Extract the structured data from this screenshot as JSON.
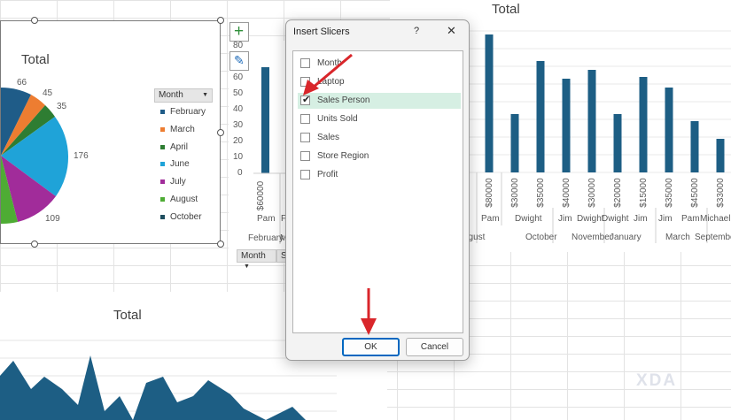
{
  "pie_chart": {
    "title": "Total",
    "slice_labels": [
      "66",
      "45",
      "35",
      "176",
      "109"
    ],
    "legend_header": "Month",
    "legend": [
      {
        "label": "February",
        "color": "#1f5c88"
      },
      {
        "label": "March",
        "color": "#ed7d31"
      },
      {
        "label": "April",
        "color": "#2e7d32"
      },
      {
        "label": "June",
        "color": "#1fa3d8"
      },
      {
        "label": "July",
        "color": "#a12c9a"
      },
      {
        "label": "August",
        "color": "#4eac34"
      },
      {
        "label": "October",
        "color": "#1f4e5f"
      }
    ]
  },
  "mid_chart": {
    "y_ticks": [
      "80",
      "70",
      "60",
      "50",
      "40",
      "30",
      "20",
      "10",
      "0"
    ],
    "bar_cat": "$60000",
    "person": "Pam",
    "person_cut": "F",
    "month": "February",
    "month_cut": "M",
    "field_btn": "Month",
    "field_btn2": "Sa"
  },
  "right_chart": {
    "title": "Total",
    "categories": [
      "$80000",
      "$30000",
      "$35000",
      "$40000",
      "$30000",
      "$20000",
      "$15000",
      "$35000",
      "$45000",
      "$33000"
    ],
    "persons": [
      "h",
      "Pam",
      "Dwight",
      "Jim",
      "Dwight",
      "Dwight",
      "Jim",
      "Jim",
      "Pam",
      "Michael"
    ],
    "months": [
      "ugust",
      "October",
      "November",
      "January",
      "March",
      "September"
    ]
  },
  "area_chart": {
    "title": "Total"
  },
  "dialog": {
    "title": "Insert Slicers",
    "help": "?",
    "close": "✕",
    "fields": [
      {
        "label": "Month",
        "checked": false
      },
      {
        "label": "Laptop",
        "checked": false
      },
      {
        "label": "Sales Person",
        "checked": true
      },
      {
        "label": "Units Sold",
        "checked": false
      },
      {
        "label": "Sales",
        "checked": false
      },
      {
        "label": "Store Region",
        "checked": false
      },
      {
        "label": "Profit",
        "checked": false
      }
    ],
    "ok_label": "OK",
    "cancel_label": "Cancel",
    "check_mark": "✔"
  },
  "tools": {
    "add_glyph": "+",
    "brush_glyph": "✎"
  },
  "watermark": "XDA",
  "colors": {
    "bar": "#1d5e84",
    "arrow": "#d9262b",
    "selection": "#d6efe3"
  },
  "chart_data": {
    "type": "bar",
    "categories": [
      "$80000",
      "$30000",
      "$35000",
      "$40000",
      "$30000",
      "$20000",
      "$15000",
      "$35000",
      "$45000",
      "$33000"
    ],
    "values": [
      78,
      33,
      63,
      53,
      58,
      33,
      54,
      48,
      29,
      19
    ],
    "title": "Total",
    "xlabel": "",
    "ylabel": "",
    "ylim": [
      0,
      80
    ]
  }
}
